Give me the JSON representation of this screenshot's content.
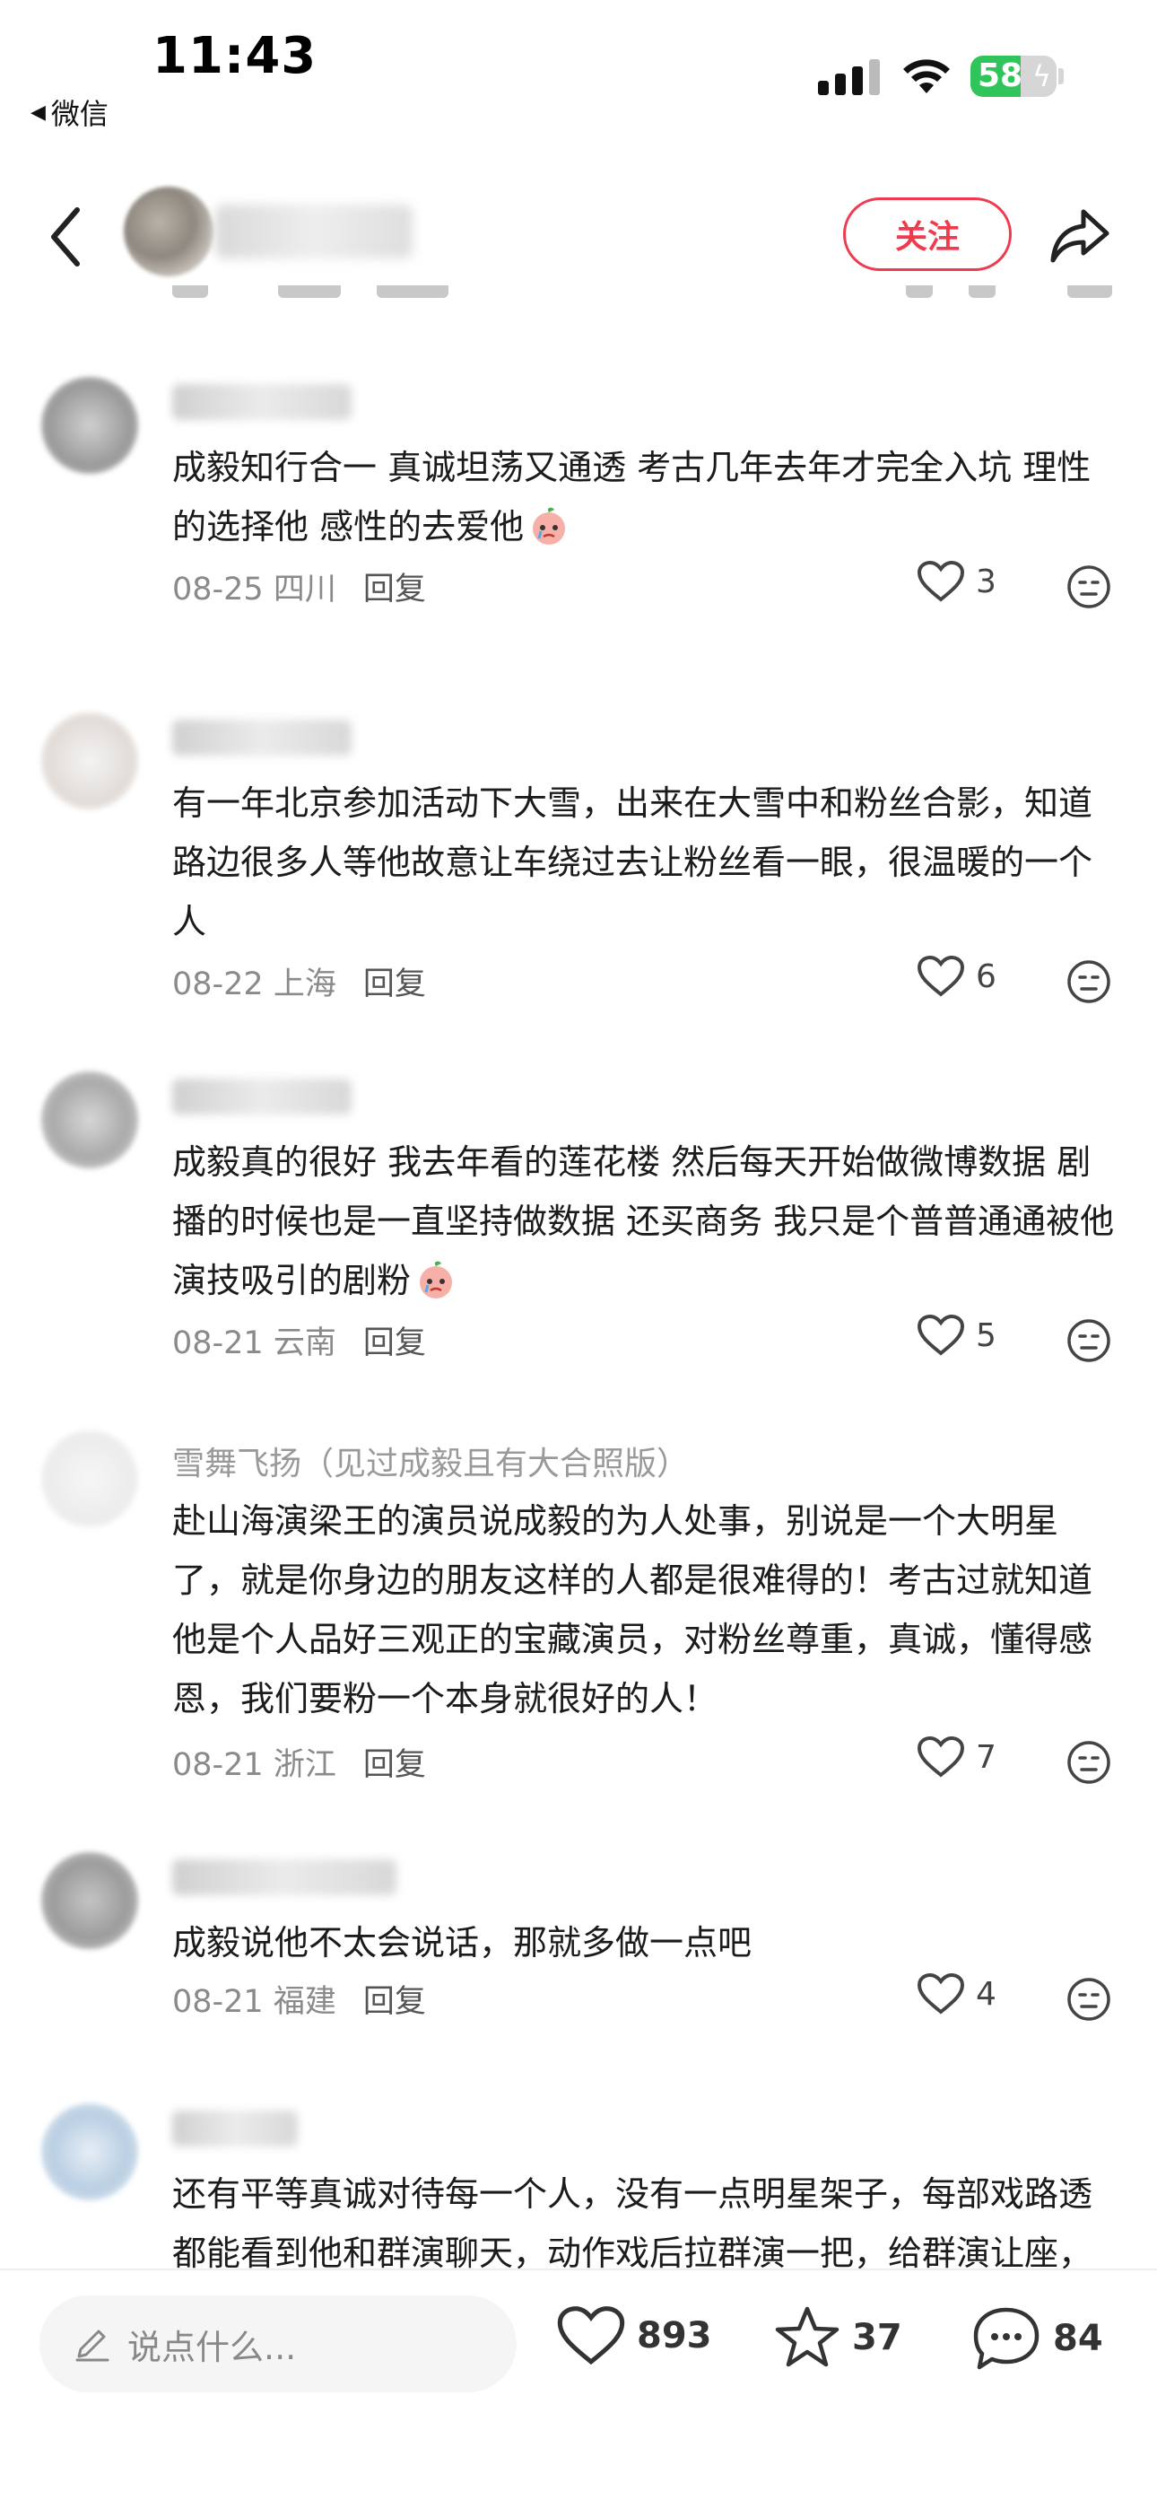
{
  "status_bar": {
    "time": "11:43",
    "back_app": "微信",
    "battery": "58",
    "battery_level": 0.58,
    "battery_color": "#30c55a"
  },
  "header": {
    "follow_label": "关注"
  },
  "colors": {
    "accent": "#ee3b4e",
    "meta_text": "#8a8a8a"
  },
  "comments": [
    {
      "user": "",
      "text": "成毅知行合一 真诚坦荡又通透 考古几年去年才完全入坑 理性的选择他 感性的去爱他",
      "emoji": "peach-crying-emoji",
      "date": "08-25",
      "location": "四川",
      "reply": "回复",
      "likes": "3"
    },
    {
      "user": "",
      "text": "有一年北京参加活动下大雪，出来在大雪中和粉丝合影，知道路边很多人等他故意让车绕过去让粉丝看一眼，很温暖的一个人",
      "date": "08-22",
      "location": "上海",
      "reply": "回复",
      "likes": "6"
    },
    {
      "user": "",
      "text": "成毅真的很好 我去年看的莲花楼 然后每天开始做微博数据 剧播的时候也是一直坚持做数据 还买商务 我只是个普普通通被他演技吸引的剧粉",
      "emoji": "peach-crying-emoji",
      "date": "08-21",
      "location": "云南",
      "reply": "回复",
      "likes": "5"
    },
    {
      "user": "雪舞飞扬（见过成毅且有大合照版）",
      "text": "赴山海演梁王的演员说成毅的为人处事，别说是一个大明星了，就是你身边的朋友这样的人都是很难得的！考古过就知道他是个人品好三观正的宝藏演员，对粉丝尊重，真诚，懂得感恩，我们要粉一个本身就很好的人！",
      "date": "08-21",
      "location": "浙江",
      "reply": "回复",
      "likes": "7"
    },
    {
      "user": "",
      "text": "成毅说他不太会说话，那就多做一点吧",
      "date": "08-21",
      "location": "福建",
      "reply": "回复",
      "likes": "4"
    },
    {
      "user": "",
      "text": "还有平等真诚对待每一个人，没有一点明星架子，每部戏路透都能看到他和群演聊天，动作戏后拉群演一把，给群演让座，他真的是个很好的人"
    }
  ],
  "bottom_bar": {
    "input_placeholder": "说点什么...",
    "likes": "893",
    "stars": "37",
    "comments": "84"
  }
}
